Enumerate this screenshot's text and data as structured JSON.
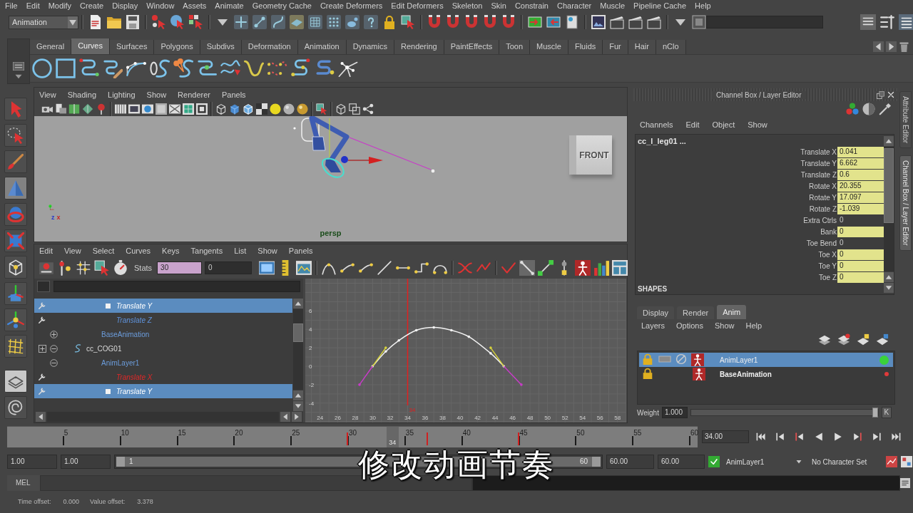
{
  "menu_bar": [
    "File",
    "Edit",
    "Modify",
    "Create",
    "Display",
    "Window",
    "Assets",
    "Animate",
    "Geometry Cache",
    "Create Deformers",
    "Edit Deformers",
    "Skeleton",
    "Skin",
    "Constrain",
    "Character",
    "Muscle",
    "Pipeline Cache",
    "Help"
  ],
  "status_line": {
    "menu_set": "Animation"
  },
  "shelf": {
    "tabs": [
      {
        "label": "General",
        "selected": false
      },
      {
        "label": "Curves",
        "selected": true
      },
      {
        "label": "Surfaces",
        "selected": false
      },
      {
        "label": "Polygons",
        "selected": false
      },
      {
        "label": "Subdivs",
        "selected": false
      },
      {
        "label": "Deformation",
        "selected": false
      },
      {
        "label": "Animation",
        "selected": false
      },
      {
        "label": "Dynamics",
        "selected": false
      },
      {
        "label": "Rendering",
        "selected": false
      },
      {
        "label": "PaintEffects",
        "selected": false
      },
      {
        "label": "Toon",
        "selected": false
      },
      {
        "label": "Muscle",
        "selected": false
      },
      {
        "label": "Fluids",
        "selected": false
      },
      {
        "label": "Fur",
        "selected": false
      },
      {
        "label": "Hair",
        "selected": false
      },
      {
        "label": "nClo",
        "selected": false
      }
    ]
  },
  "toolbox": [
    {
      "selected": false
    },
    {
      "selected": false
    },
    {
      "selected": false
    },
    {
      "selected": true
    },
    {
      "selected": false
    },
    {
      "selected": false
    },
    {
      "selected": false
    },
    {
      "selected": false
    },
    {
      "selected": false
    },
    {
      "selected": false
    }
  ],
  "viewport": {
    "menu": [
      "View",
      "Shading",
      "Lighting",
      "Show",
      "Renderer",
      "Panels"
    ],
    "view_cube": "FRONT",
    "axis_labels": [
      "z",
      "x"
    ],
    "camera": "persp"
  },
  "graph_editor": {
    "menu": [
      "Edit",
      "View",
      "Select",
      "Curves",
      "Keys",
      "Tangents",
      "List",
      "Show",
      "Panels"
    ],
    "stats_label": "Stats",
    "stats": [
      {
        "value": "30",
        "highlighted": true
      },
      {
        "value": "0",
        "highlighted": false
      }
    ],
    "outliner": [
      {
        "children": [
          {
            "children": [
              {
                "kind": "channel",
                "label": "Translate Y",
                "selected": true
              },
              {
                "kind": "channel",
                "label": "Translate Z",
                "selected": false,
                "color": "#5f93dc"
              }
            ]
          },
          {
            "kind": "layer",
            "label": "BaseAnimation",
            "selected": false,
            "expanded": false
          }
        ]
      },
      {
        "kind": "object",
        "label": "cc_COG01",
        "selected": false,
        "expanded": true,
        "children": [
          {
            "kind": "layer",
            "label": "AnimLayer1",
            "selected": false,
            "expanded": true,
            "children": [
              {
                "kind": "channel",
                "label": "Translate X",
                "selected": false,
                "color": "#e02828"
              },
              {
                "kind": "channel",
                "label": "Translate Y",
                "selected": true
              }
            ]
          }
        ]
      }
    ],
    "chart_data": {
      "type": "line",
      "x": [
        28.5,
        30,
        31.5,
        33,
        35,
        37,
        39,
        41,
        43.5,
        45,
        47
      ],
      "series": [
        {
          "color": "#f2f2f2",
          "values": [
            null,
            0,
            1.6,
            2.8,
            3.9,
            4.2,
            3.9,
            3.2,
            1.4,
            0,
            null
          ]
        },
        {
          "color": "#d6d23c",
          "values": [
            null,
            0,
            2,
            null,
            null,
            null,
            null,
            null,
            2,
            0,
            null
          ]
        },
        {
          "color": "#c83cc8",
          "values": [
            -2,
            0,
            null,
            null,
            null,
            null,
            null,
            null,
            null,
            0,
            -2
          ]
        }
      ],
      "xlim": [
        22.3,
        59
      ],
      "ylim": [
        -6.1,
        9.5
      ],
      "xticks": [
        24,
        26,
        28,
        30,
        32,
        34,
        36,
        38,
        40,
        42,
        44,
        46,
        48,
        50,
        52,
        54,
        56,
        58
      ],
      "yticks": [
        -4,
        -2,
        0,
        2,
        4,
        6
      ],
      "grid": true,
      "ref_lines": [
        {
          "axis": "x",
          "value": 34,
          "label": "34",
          "color": "#e02020"
        }
      ]
    }
  },
  "channel_box": {
    "title": "Channel Box / Layer Editor",
    "menu": [
      "Channels",
      "Edit",
      "Object",
      "Show"
    ],
    "object": "cc_l_leg01 ...",
    "channels": [
      {
        "name": "Translate X",
        "value": "0.041",
        "keyed": true
      },
      {
        "name": "Translate Y",
        "value": "6.662",
        "keyed": true
      },
      {
        "name": "Translate Z",
        "value": "0.6",
        "keyed": true
      },
      {
        "name": "Rotate X",
        "value": "20.355",
        "keyed": true
      },
      {
        "name": "Rotate Y",
        "value": "17.097",
        "keyed": true
      },
      {
        "name": "Rotate Z",
        "value": "-1.039",
        "keyed": true
      },
      {
        "name": "Extra Ctrls",
        "value": "0",
        "keyed": false
      },
      {
        "name": "Bank",
        "value": "0",
        "keyed": true
      },
      {
        "name": "Toe Bend",
        "value": "0",
        "keyed": false
      },
      {
        "name": "Toe X",
        "value": "0",
        "keyed": true
      },
      {
        "name": "Toe Y",
        "value": "0",
        "keyed": true
      },
      {
        "name": "Toe Z",
        "value": "0",
        "keyed": true
      }
    ],
    "section": "SHAPES"
  },
  "side_tabs": [
    {
      "label": "Attribute Editor",
      "selected": false
    },
    {
      "label": "Channel Box / Layer Editor",
      "selected": true
    }
  ],
  "layer_editor": {
    "tabs": [
      {
        "label": "Display",
        "selected": false
      },
      {
        "label": "Render",
        "selected": false
      },
      {
        "label": "Anim",
        "selected": true
      }
    ],
    "menu": [
      "Layers",
      "Options",
      "Show",
      "Help"
    ],
    "layers": [
      {
        "name": "AnimLayer1",
        "kind": "layer",
        "selected": true,
        "color": "#3ad23a"
      },
      {
        "name": "BaseAnimation",
        "kind": "base",
        "selected": false,
        "color": "#e03a3a"
      }
    ],
    "weight": {
      "label": "Weight",
      "value": "1.000",
      "level": 1,
      "key_button": "K"
    }
  },
  "timeline": {
    "ticks": [
      "5",
      "10",
      "15",
      "20",
      "25",
      "30",
      "35",
      "40",
      "45",
      "50",
      "55",
      "60"
    ],
    "keys": [
      {
        "level": 0.4915
      },
      {
        "level": 0.6102
      },
      {
        "level": 0.7458
      }
    ],
    "current": {
      "label": "34",
      "level": 0.5593
    },
    "current_time": "34.00"
  },
  "range_slider": {
    "start_time": "1.00",
    "range_start": "1.00",
    "handle_start": "1",
    "handle_end": "60",
    "level": 1,
    "range_end": "60.00",
    "end_time": "60.00",
    "anim_layer": "AnimLayer1",
    "character_set": "No Character Set"
  },
  "subtitle": "修改动画节奏",
  "command_line": {
    "label": "MEL"
  },
  "help_line": [
    {
      "label": "Time offset:",
      "value": "0.000"
    },
    {
      "label": "Value offset:",
      "value": "3.378"
    }
  ]
}
